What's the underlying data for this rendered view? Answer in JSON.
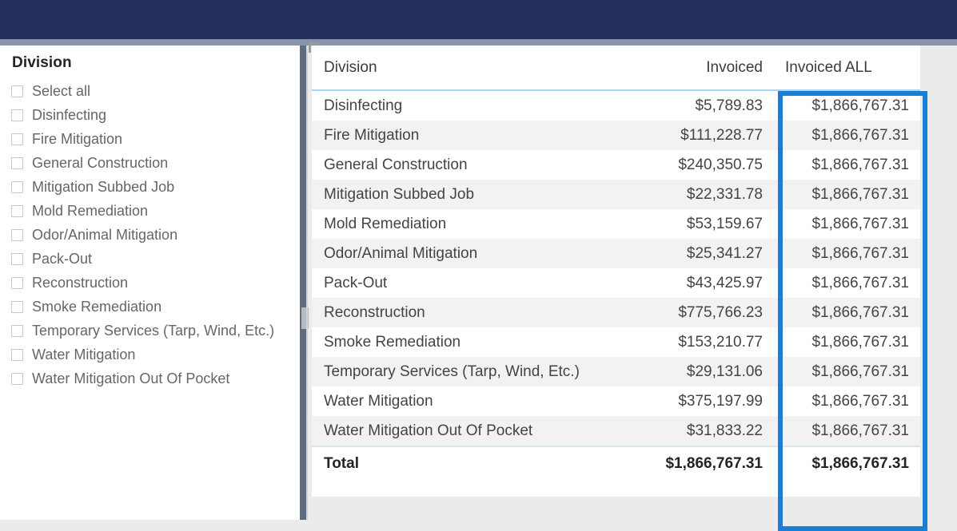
{
  "window": {
    "topbar_color": "#25315c",
    "strip_color": "#8794ac",
    "canvas_background": "#ebebeb"
  },
  "slicer": {
    "title": "Division",
    "items": [
      {
        "label": "Select all",
        "checked": false
      },
      {
        "label": "Disinfecting",
        "checked": false
      },
      {
        "label": "Fire Mitigation",
        "checked": false
      },
      {
        "label": "General Construction",
        "checked": false
      },
      {
        "label": "Mitigation Subbed Job",
        "checked": false
      },
      {
        "label": "Mold Remediation",
        "checked": false
      },
      {
        "label": "Odor/Animal Mitigation",
        "checked": false
      },
      {
        "label": "Pack-Out",
        "checked": false
      },
      {
        "label": "Reconstruction",
        "checked": false
      },
      {
        "label": "Smoke Remediation",
        "checked": false
      },
      {
        "label": "Temporary Services (Tarp, Wind, Etc.)",
        "checked": false
      },
      {
        "label": "Water Mitigation",
        "checked": false
      },
      {
        "label": "Water Mitigation Out Of Pocket",
        "checked": false
      }
    ]
  },
  "table": {
    "columns": [
      "Division",
      "Invoiced",
      "Invoiced ALL"
    ],
    "rows": [
      {
        "division": "Disinfecting",
        "invoiced": "$5,789.83",
        "invoiced_all": "$1,866,767.31"
      },
      {
        "division": "Fire Mitigation",
        "invoiced": "$111,228.77",
        "invoiced_all": "$1,866,767.31"
      },
      {
        "division": "General Construction",
        "invoiced": "$240,350.75",
        "invoiced_all": "$1,866,767.31"
      },
      {
        "division": "Mitigation Subbed Job",
        "invoiced": "$22,331.78",
        "invoiced_all": "$1,866,767.31"
      },
      {
        "division": "Mold Remediation",
        "invoiced": "$53,159.67",
        "invoiced_all": "$1,866,767.31"
      },
      {
        "division": "Odor/Animal Mitigation",
        "invoiced": "$25,341.27",
        "invoiced_all": "$1,866,767.31"
      },
      {
        "division": "Pack-Out",
        "invoiced": "$43,425.97",
        "invoiced_all": "$1,866,767.31"
      },
      {
        "division": "Reconstruction",
        "invoiced": "$775,766.23",
        "invoiced_all": "$1,866,767.31"
      },
      {
        "division": "Smoke Remediation",
        "invoiced": "$153,210.77",
        "invoiced_all": "$1,866,767.31"
      },
      {
        "division": "Temporary Services (Tarp, Wind, Etc.)",
        "invoiced": "$29,131.06",
        "invoiced_all": "$1,866,767.31"
      },
      {
        "division": "Water Mitigation",
        "invoiced": "$375,197.99",
        "invoiced_all": "$1,866,767.31"
      },
      {
        "division": "Water Mitigation Out Of Pocket",
        "invoiced": "$31,833.22",
        "invoiced_all": "$1,866,767.31"
      }
    ],
    "total": {
      "division": "Total",
      "invoiced": "$1,866,767.31",
      "invoiced_all": "$1,866,767.31"
    }
  },
  "annotation": {
    "highlight_color": "#1a7fd4",
    "target_column": "Invoiced ALL"
  }
}
